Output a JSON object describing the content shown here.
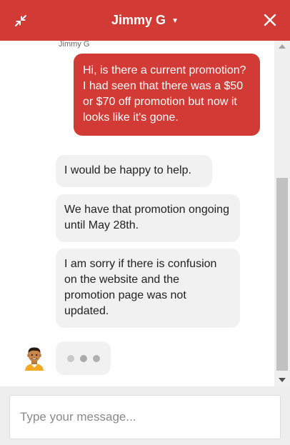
{
  "header": {
    "title": "Jimmy G",
    "caret_icon": "caret-down-icon",
    "minimize_icon": "minimize-arrows-icon",
    "close_icon": "close-icon",
    "bg_color": "#d23b35"
  },
  "conversation": {
    "sender_label": "Jimmy G",
    "outgoing_message": "Hi, is there a current promotion?  I had seen that there was a $50 or $70 off promotion but now it looks like it's gone.",
    "incoming_messages": [
      "I would be happy to help.",
      "We have that promotion ongoing until May 28th.",
      "I am sorry if there is confusion on the website and the promotion page was not updated."
    ],
    "typing_indicator": "typing-dots-icon",
    "agent_avatar": "agent-avatar-icon"
  },
  "composer": {
    "placeholder": "Type your message..."
  }
}
